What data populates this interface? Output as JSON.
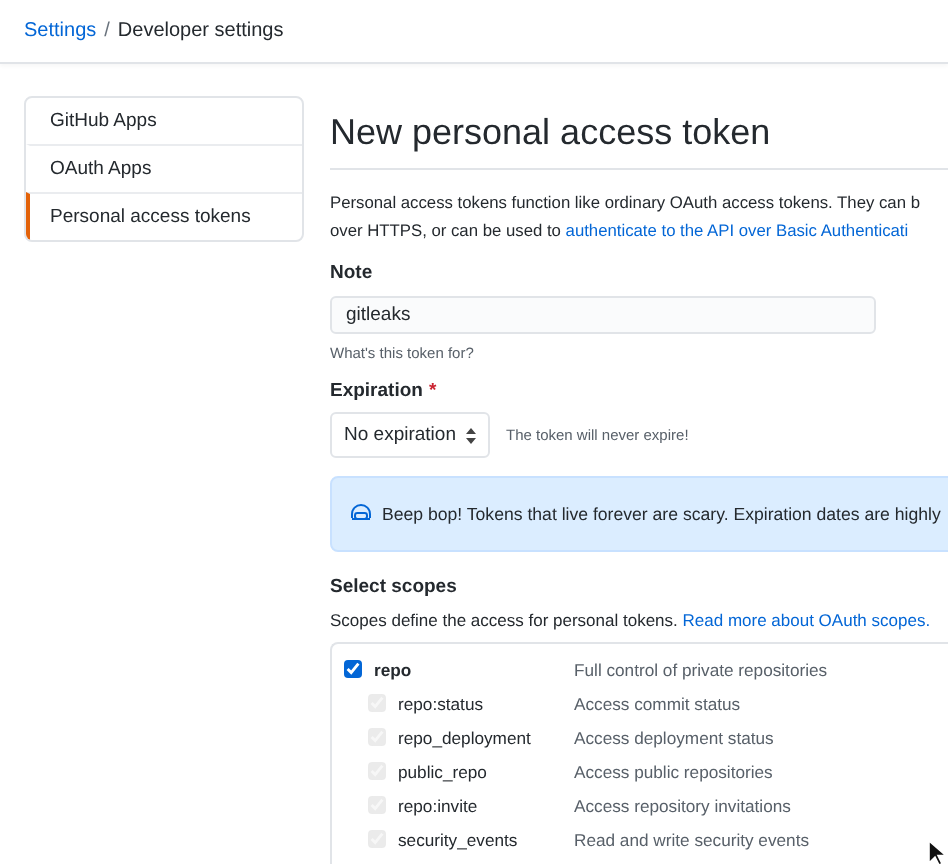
{
  "breadcrumb": [
    {
      "label": "Settings",
      "kind": "link"
    },
    {
      "label": "Developer settings",
      "kind": "current"
    }
  ],
  "breadcrumb_separator": "/",
  "sidebar": {
    "items": [
      {
        "label": "GitHub Apps",
        "selected": false
      },
      {
        "label": "OAuth Apps",
        "selected": false
      },
      {
        "label": "Personal access tokens",
        "selected": true
      }
    ]
  },
  "main": {
    "title": "New personal access token",
    "intro": {
      "text": "Personal access tokens function like ordinary OAuth access tokens. They can b",
      "text2": "over HTTPS, or can be used to",
      "link": "authenticate to the API over Basic Authenticati"
    },
    "note": {
      "label": "Note",
      "value": "gitleaks",
      "hint": "What's this token for?"
    },
    "expiration": {
      "label": "Expiration",
      "required_marker": "*",
      "value": "No expiration",
      "hint": "The token will never expire!"
    },
    "banner": {
      "text": "Beep bop! Tokens that live forever are scary. Expiration dates are highly"
    },
    "scopes": {
      "label": "Select scopes",
      "description": "Scopes define the access for personal tokens.",
      "link": "Read more about OAuth scopes.",
      "items": [
        {
          "name": "repo",
          "description": "Full control of private repositories",
          "checked": true,
          "disabled": false,
          "children": [
            {
              "name": "repo:status",
              "description": "Access commit status",
              "checked": true,
              "disabled": true
            },
            {
              "name": "repo_deployment",
              "description": "Access deployment status",
              "checked": true,
              "disabled": true
            },
            {
              "name": "public_repo",
              "description": "Access public repositories",
              "checked": true,
              "disabled": true
            },
            {
              "name": "repo:invite",
              "description": "Access repository invitations",
              "checked": true,
              "disabled": true
            },
            {
              "name": "security_events",
              "description": "Read and write security events",
              "checked": true,
              "disabled": true
            }
          ]
        }
      ]
    }
  }
}
